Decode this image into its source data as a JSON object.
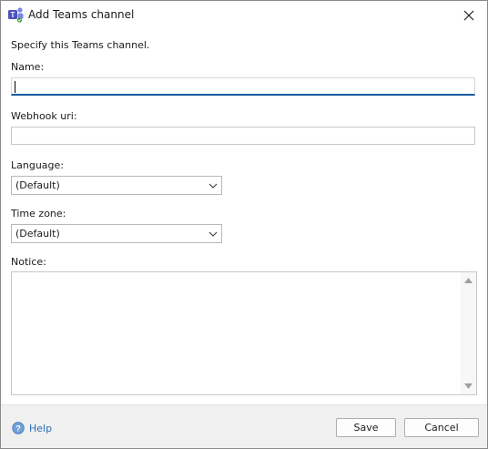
{
  "window": {
    "title": "Add Teams channel"
  },
  "form": {
    "instruction": "Specify this Teams channel.",
    "name": {
      "label": "Name:",
      "value": "",
      "placeholder": ""
    },
    "webhook": {
      "label": "Webhook uri:",
      "value": "",
      "placeholder": ""
    },
    "language": {
      "label": "Language:",
      "selected": "(Default)"
    },
    "timezone": {
      "label": "Time zone:",
      "selected": "(Default)"
    },
    "notice": {
      "label": "Notice:",
      "value": ""
    }
  },
  "footer": {
    "help_label": "Help",
    "save_label": "Save",
    "cancel_label": "Cancel"
  },
  "colors": {
    "accent": "#0f5b9e",
    "link": "#2f6fb2",
    "footer_bg": "#f0f0f0",
    "teams_purple": "#5b5fc7"
  },
  "icons": {
    "app": "teams-icon",
    "close": "close-icon",
    "help": "help-icon",
    "dropdown": "chevron-down-icon"
  }
}
